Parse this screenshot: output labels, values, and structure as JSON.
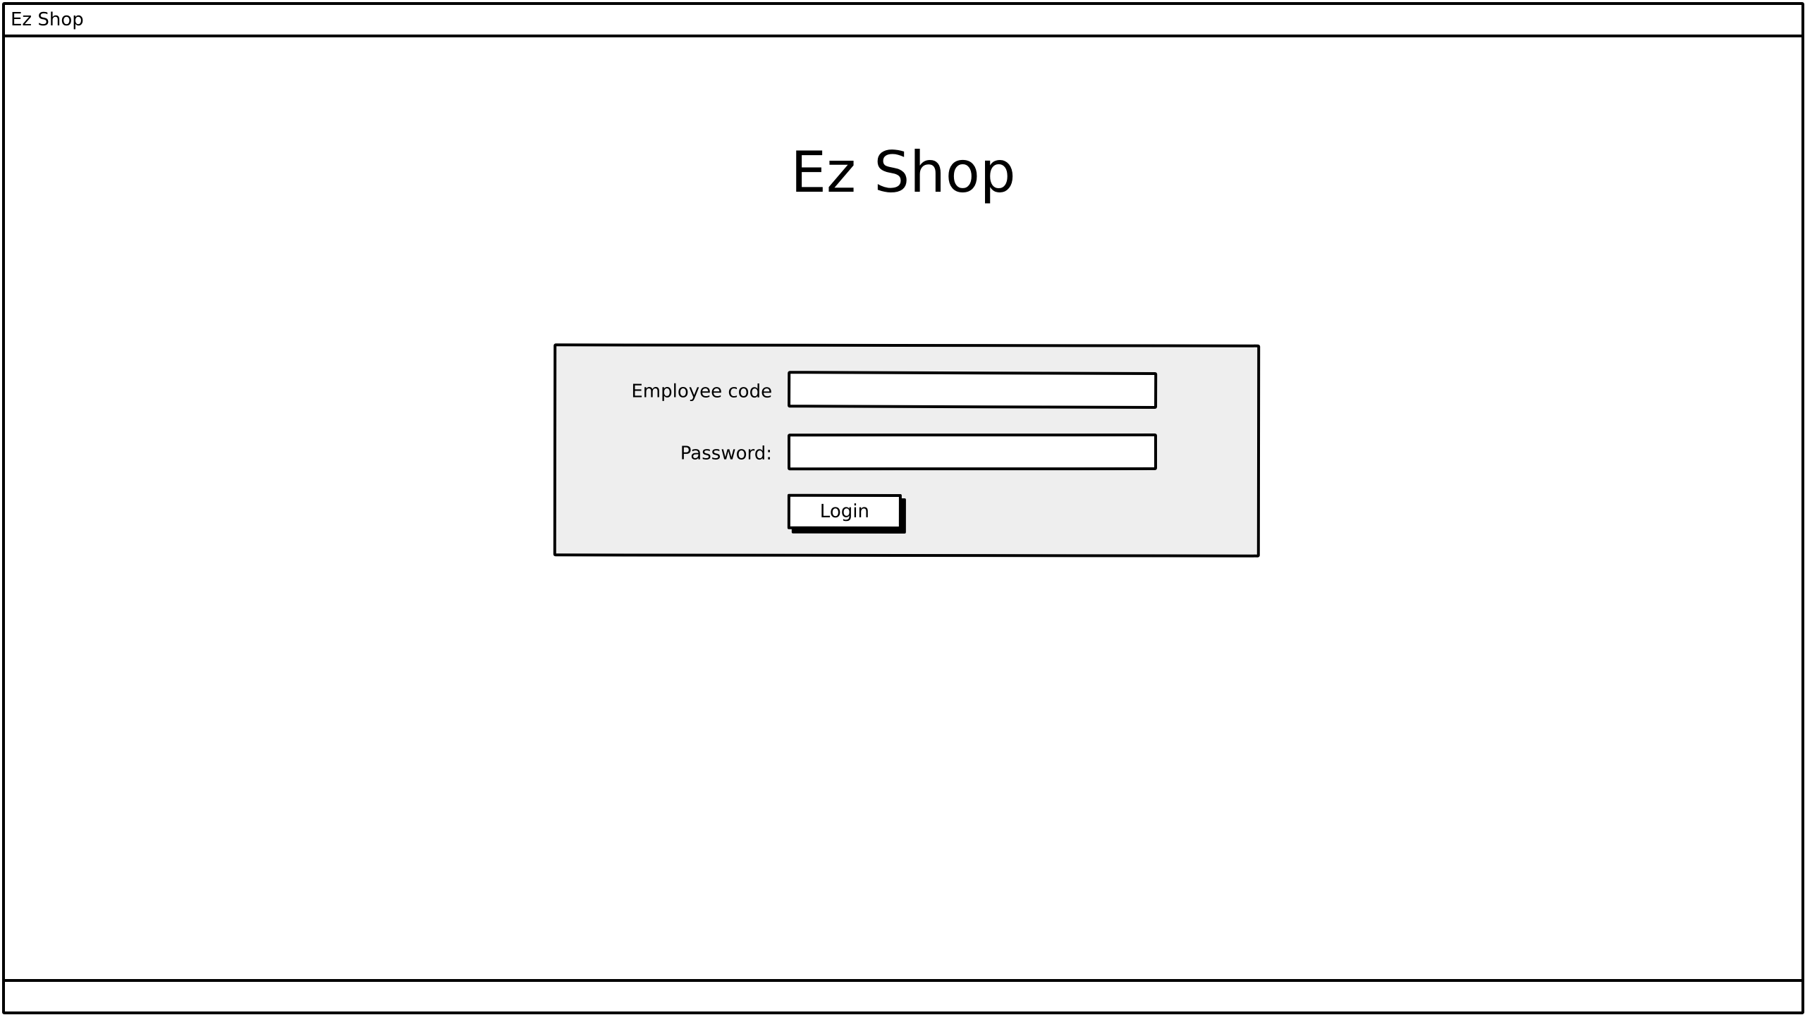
{
  "window": {
    "title": "Ez Shop"
  },
  "main": {
    "heading": "Ez Shop"
  },
  "login_form": {
    "employee_code_label": "Employee code",
    "employee_code_value": "",
    "password_label": "Password:",
    "password_value": "",
    "login_button_label": "Login"
  },
  "colors": {
    "panel_background": "#eeeeee",
    "border": "#000000",
    "background": "#ffffff"
  }
}
